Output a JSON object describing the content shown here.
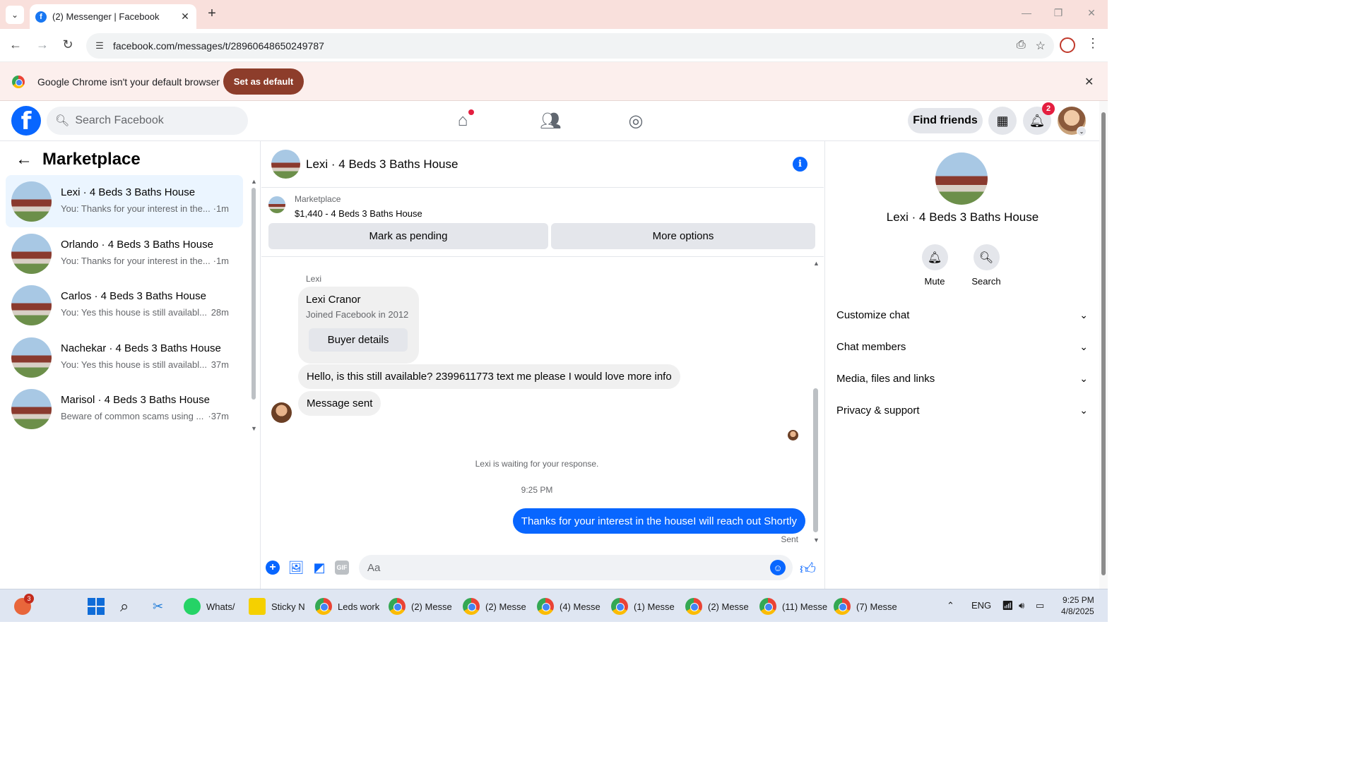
{
  "browser": {
    "tab_title": "(2) Messenger | Facebook",
    "url": "facebook.com/messages/t/28960648650249787",
    "infobar_text": "Google Chrome isn't your default browser",
    "set_default_label": "Set as default"
  },
  "fb_header": {
    "search_placeholder": "Search Facebook",
    "find_friends_label": "Find friends",
    "notification_count": "2"
  },
  "sidebar": {
    "title": "Marketplace",
    "conversations": [
      {
        "name": "Lexi · 4 Beds 3 Baths House",
        "preview": "You: Thanks for your interest in the...",
        "time": "·1m"
      },
      {
        "name": "Orlando · 4 Beds 3 Baths House",
        "preview": "You: Thanks for your interest in the...",
        "time": "·1m"
      },
      {
        "name": "Carlos · 4 Beds 3 Baths House",
        "preview": "You: Yes this house is still availabl...",
        "time": "28m"
      },
      {
        "name": "Nachekar · 4 Beds 3 Baths House",
        "preview": "You: Yes this house is still availabl...",
        "time": "37m"
      },
      {
        "name": "Marisol · 4 Beds 3 Baths House",
        "preview": "Beware of common scams using ...",
        "time": "·37m"
      }
    ]
  },
  "chat": {
    "title": "Lexi · 4 Beds 3 Baths House",
    "listing_label": "Marketplace",
    "listing_price": "$1,440 - 4 Beds 3 Baths House",
    "mark_pending_label": "Mark as pending",
    "more_options_label": "More options",
    "sender_label": "Lexi",
    "profile_name": "Lexi Cranor",
    "profile_joined": "Joined Facebook in 2012",
    "buyer_details_label": "Buyer details",
    "incoming_message": "Hello, is this still available? 2399611773 text me please I would love more info",
    "system_message": "Message sent",
    "waiting_text": "Lexi is waiting for your response.",
    "time_separator": "9:25 PM",
    "outgoing_message": "Thanks for your interest in the houseI will reach out Shortly",
    "sent_status": "Sent",
    "composer_placeholder": "Aa"
  },
  "right_panel": {
    "title": "Lexi · 4 Beds 3 Baths House",
    "mute_label": "Mute",
    "search_label": "Search",
    "sections": [
      "Customize chat",
      "Chat members",
      "Media, files and links",
      "Privacy & support"
    ]
  },
  "taskbar": {
    "badge_count": "3",
    "items": [
      "Whats/",
      "Sticky N",
      "Leds work",
      "(2) Messe",
      "(2) Messe",
      "(4) Messe",
      "(1) Messe",
      "(2) Messe",
      "(11) Messe",
      "(7) Messe"
    ],
    "language": "ENG",
    "time": "9:25 PM",
    "date": "4/8/2025"
  },
  "colors": {
    "fb_blue": "#0866ff",
    "set_default_bg": "#8d3d2b",
    "active_conv_bg": "#ebf5ff",
    "notification_red": "#e41e3f"
  }
}
